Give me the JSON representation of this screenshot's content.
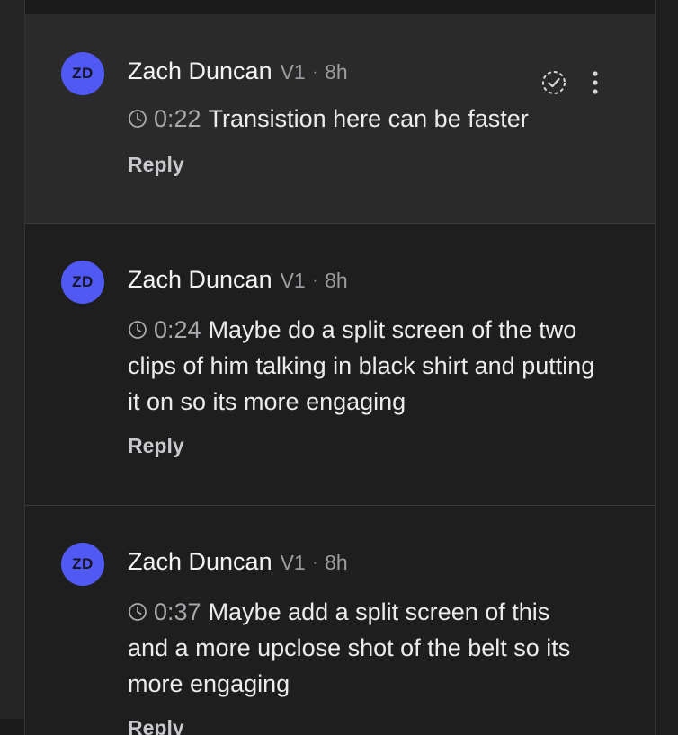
{
  "comments": [
    {
      "avatar_initials": "ZD",
      "author": "Zach Duncan",
      "version": "V1",
      "separator": "·",
      "age": "8h",
      "timestamp": "0:22",
      "text": "Transistion here can be faster",
      "reply_label": "Reply",
      "highlighted": true,
      "icons": [
        "clock-icon",
        "resolve-check-icon",
        "more-vertical-icon"
      ]
    },
    {
      "avatar_initials": "ZD",
      "author": "Zach Duncan",
      "version": "V1",
      "separator": "·",
      "age": "8h",
      "timestamp": "0:24",
      "text": "Maybe do a split screen of the two clips of him talking in black shirt and putting it on so its more engaging",
      "reply_label": "Reply",
      "highlighted": false,
      "icons": [
        "clock-icon"
      ]
    },
    {
      "avatar_initials": "ZD",
      "author": "Zach Duncan",
      "version": "V1",
      "separator": "·",
      "age": "8h",
      "timestamp": "0:37",
      "text": "Maybe add a split screen of this and a more upclose shot of the belt so its more engaging",
      "reply_label": "Reply",
      "highlighted": false,
      "icons": [
        "clock-icon"
      ]
    }
  ],
  "colors": {
    "avatar_bg": "#5159f5",
    "panel_bg": "#1e1e1f",
    "active_bg": "#2a2a2b",
    "text_primary": "#ececee",
    "text_muted": "#9c9ca1"
  }
}
